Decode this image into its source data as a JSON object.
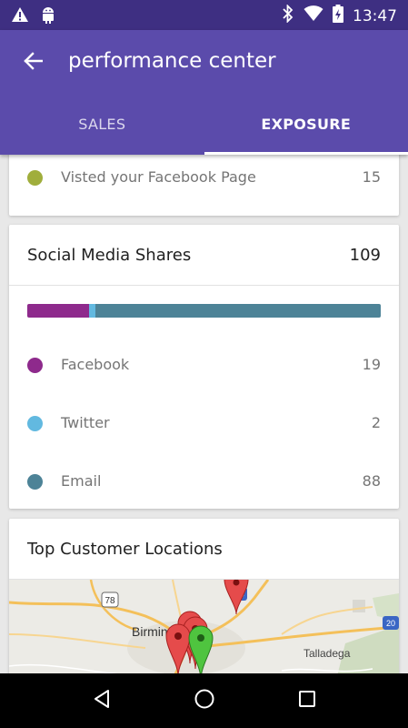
{
  "status_bar": {
    "time": "13:47",
    "left_icons": [
      "warning-icon",
      "android-icon"
    ],
    "right_icons": [
      "bluetooth-icon",
      "wifi-icon",
      "battery-charging-icon"
    ]
  },
  "app_bar": {
    "title": "performance center",
    "back_icon": "arrow-left-icon",
    "color": "#5b4bab"
  },
  "tabs": [
    {
      "label": "SALES",
      "active": false
    },
    {
      "label": "EXPOSURE",
      "active": true
    }
  ],
  "visits_card": {
    "row": {
      "label": "Visted your Facebook Page",
      "value": "15",
      "color": "#a0ae3c"
    }
  },
  "social_card": {
    "title": "Social Media Shares",
    "total": "109",
    "rows": [
      {
        "label": "Facebook",
        "value": "19",
        "color": "#8e2a8c"
      },
      {
        "label": "Twitter",
        "value": "2",
        "color": "#62b9e0"
      },
      {
        "label": "Email",
        "value": "88",
        "color": "#4d8397"
      }
    ]
  },
  "locations_card": {
    "title": "Top Customer Locations",
    "map_labels": {
      "city": "Birmingham",
      "town": "Talladega",
      "route_78": "78",
      "route_59": "59",
      "route_20": "20"
    }
  },
  "nav_bar": {
    "buttons": [
      "back-triangle-icon",
      "home-circle-icon",
      "recents-square-icon"
    ]
  }
}
